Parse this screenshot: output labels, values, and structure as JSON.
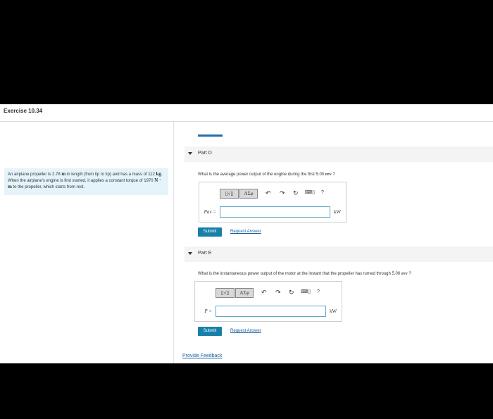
{
  "header": {
    "title": "Exercise 10.34"
  },
  "problem": {
    "text_1": "An airplane propeller is 2.78 ",
    "unit_m": "m",
    "text_2": " in length (from tip to tip) and has a mass of 112 ",
    "unit_kg": "kg",
    "text_3": ". When the airplane's engine is first started, it applies a constant torque of 1970 ",
    "unit_nm": "N · m",
    "text_4": " to the propeller, which starts from rest."
  },
  "parts": [
    {
      "label": "Part D",
      "question_text": "What is the average power output of the engine during the first 5.00 ",
      "question_unit": "rev",
      "question_end": " ?",
      "variable": "Pav =",
      "unit": "kW",
      "input_value": "",
      "submit": "Submit",
      "request": "Request Answer"
    },
    {
      "label": "Part E",
      "question_text": "What is the instantaneous power output of the motor at the instant that the propeller has turned through 5.00 ",
      "question_unit": "rev",
      "question_end": " ?",
      "variable": "P =",
      "unit": "kW",
      "input_value": "",
      "submit": "Submit",
      "request": "Request Answer"
    }
  ],
  "toolbar": {
    "templates_label": "▯√▯",
    "symbols_label": "ΑΣφ",
    "help_label": "?"
  },
  "footer": {
    "feedback": "Provide Feedback"
  }
}
